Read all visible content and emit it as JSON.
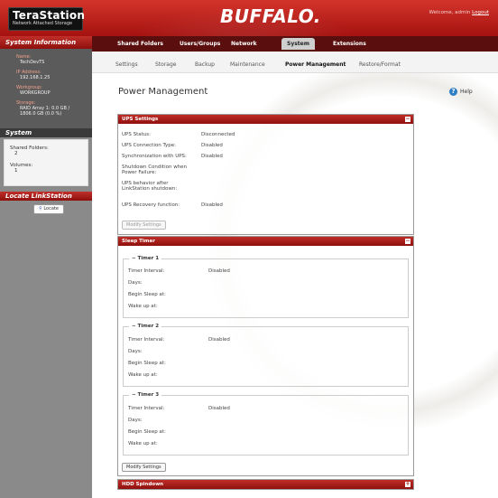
{
  "header": {
    "logo_title": "TeraStation",
    "logo_subtitle": "Network Attached Storage",
    "brand": "BUFFALO.",
    "welcome_prefix": "Welcome, admin",
    "logout": "Logout"
  },
  "sidebar": {
    "system_info_title": "System Information",
    "name_label": "Name:",
    "name_value": "TechDevTS",
    "ip_label": "IP Address:",
    "ip_value": "192.168.1.25",
    "workgroup_label": "Workgroup:",
    "workgroup_value": "WORKGROUP",
    "storage_label": "Storage:",
    "storage_value_1": "RAID Array 1: 0.0 GB /",
    "storage_value_2": "1806.0 GB (0.0 %)",
    "system_title": "System",
    "shared_folders_label": "Shared Folders:",
    "shared_folders_value": "2",
    "volumes_label": "Volumes:",
    "volumes_value": "1",
    "locate_title": "Locate LinkStation",
    "locate_button": "Locate"
  },
  "tabs": [
    "Shared Folders",
    "Users/Groups",
    "Network",
    "System",
    "Extensions"
  ],
  "active_tab": "System",
  "subtabs": [
    "Settings",
    "Storage",
    "Backup",
    "Maintenance",
    "Power Management",
    "Restore/Format"
  ],
  "active_subtab": "Power Management",
  "page": {
    "title": "Power Management",
    "help": "Help"
  },
  "ups": {
    "title": "UPS Settings",
    "rows": [
      {
        "label": "UPS Status:",
        "value": "Disconnected"
      },
      {
        "label": "UPS Connection Type:",
        "value": "Disabled"
      },
      {
        "label": "Synchronization with UPS:",
        "value": "Disabled"
      },
      {
        "label": "Shutdown Condition when Power Failure:",
        "value": ""
      },
      {
        "label": "UPS behavior after LinkStation shutdown:",
        "value": ""
      },
      {
        "label": "UPS Recovery function:",
        "value": "Disabled"
      }
    ],
    "modify_button": "Modify Settings"
  },
  "sleep": {
    "title": "Sleep Timer",
    "timers": [
      {
        "legend": "Timer 1",
        "interval_label": "Timer Interval:",
        "interval_value": "Disabled",
        "days_label": "Days:",
        "begin_label": "Begin Sleep at:",
        "wake_label": "Wake up at:"
      },
      {
        "legend": "Timer 2",
        "interval_label": "Timer Interval:",
        "interval_value": "Disabled",
        "days_label": "Days:",
        "begin_label": "Begin Sleep at:",
        "wake_label": "Wake up at:"
      },
      {
        "legend": "Timer 3",
        "interval_label": "Timer Interval:",
        "interval_value": "Disabled",
        "days_label": "Days:",
        "begin_label": "Begin Sleep at:",
        "wake_label": "Wake up at:"
      }
    ],
    "modify_button": "Modify Settings"
  },
  "hdd": {
    "title": "HDD Spindown"
  }
}
